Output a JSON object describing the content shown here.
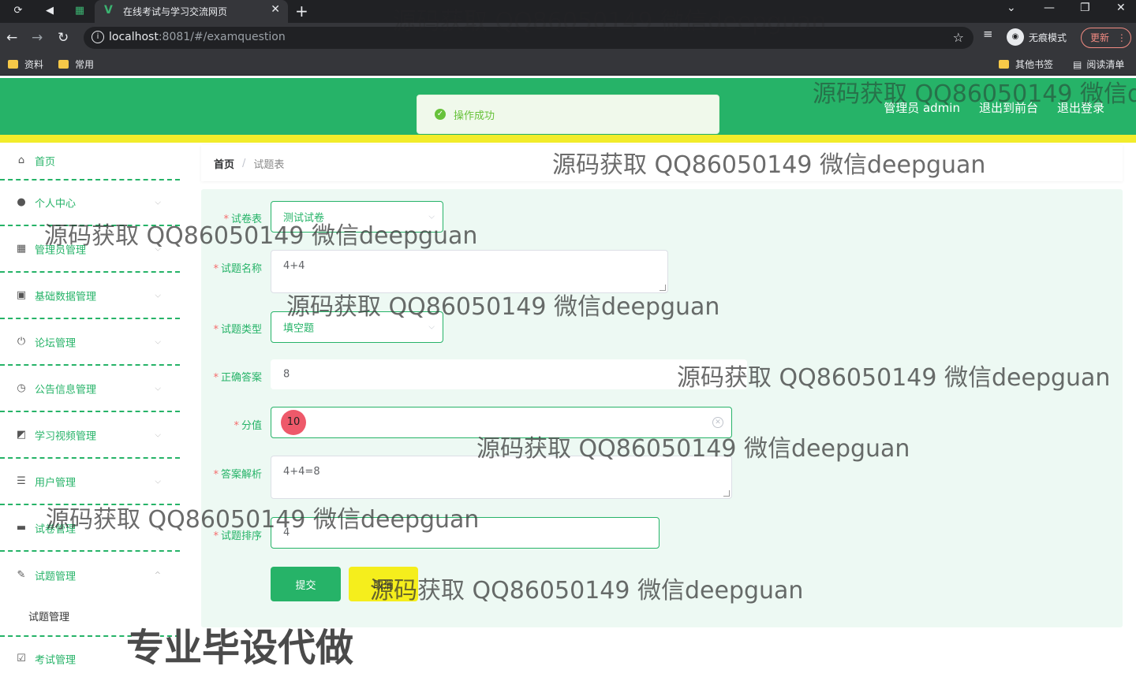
{
  "browser": {
    "tab_title": "在线考试与学习交流网页",
    "url_host": "localhost",
    "url_rest": ":8081/#/examquestion",
    "incognito_label": "无痕模式",
    "update_label": "更新",
    "bookmarks": [
      "资料",
      "常用"
    ],
    "other_bookmarks": "其他书签",
    "reading_list": "阅读清单"
  },
  "header": {
    "admin_label": "管理员 admin",
    "goto_front": "退出到前台",
    "logout": "退出登录",
    "toast": "操作成功"
  },
  "sidebar": {
    "items": [
      {
        "label": "首页",
        "icon": "home-icon"
      },
      {
        "label": "个人中心",
        "icon": "user-icon"
      },
      {
        "label": "管理员管理",
        "icon": "grid-icon"
      },
      {
        "label": "基础数据管理",
        "icon": "data-icon"
      },
      {
        "label": "论坛管理",
        "icon": "power-icon"
      },
      {
        "label": "公告信息管理",
        "icon": "clock-icon"
      },
      {
        "label": "学习视频管理",
        "icon": "chart-icon"
      },
      {
        "label": "用户管理",
        "icon": "list-icon"
      },
      {
        "label": "试卷管理",
        "icon": "chat-icon"
      },
      {
        "label": "试题管理",
        "icon": "edit-icon"
      },
      {
        "label": "考试管理",
        "icon": "check-icon"
      }
    ],
    "subitem": "试题管理"
  },
  "breadcrumb": {
    "home": "首页",
    "separator": "/",
    "current": "试题表"
  },
  "form": {
    "paper_label": "试卷表",
    "paper_value": "测试试卷",
    "name_label": "试题名称",
    "name_value": "4+4",
    "type_label": "试题类型",
    "type_value": "填空题",
    "answer_label": "正确答案",
    "answer_value": "8",
    "score_label": "分值",
    "score_value": "10",
    "analysis_label": "答案解析",
    "analysis_value": "4+4=8",
    "order_label": "试题排序",
    "order_value": "4",
    "submit": "提交",
    "cancel": "取消"
  },
  "watermarks": {
    "text": "源码获取 QQ86050149 微信deepguan",
    "promo": "专业毕设代做"
  },
  "colors": {
    "primary": "#26b368",
    "yellow": "#f2ec2a",
    "form_bg": "#edf9f3"
  }
}
